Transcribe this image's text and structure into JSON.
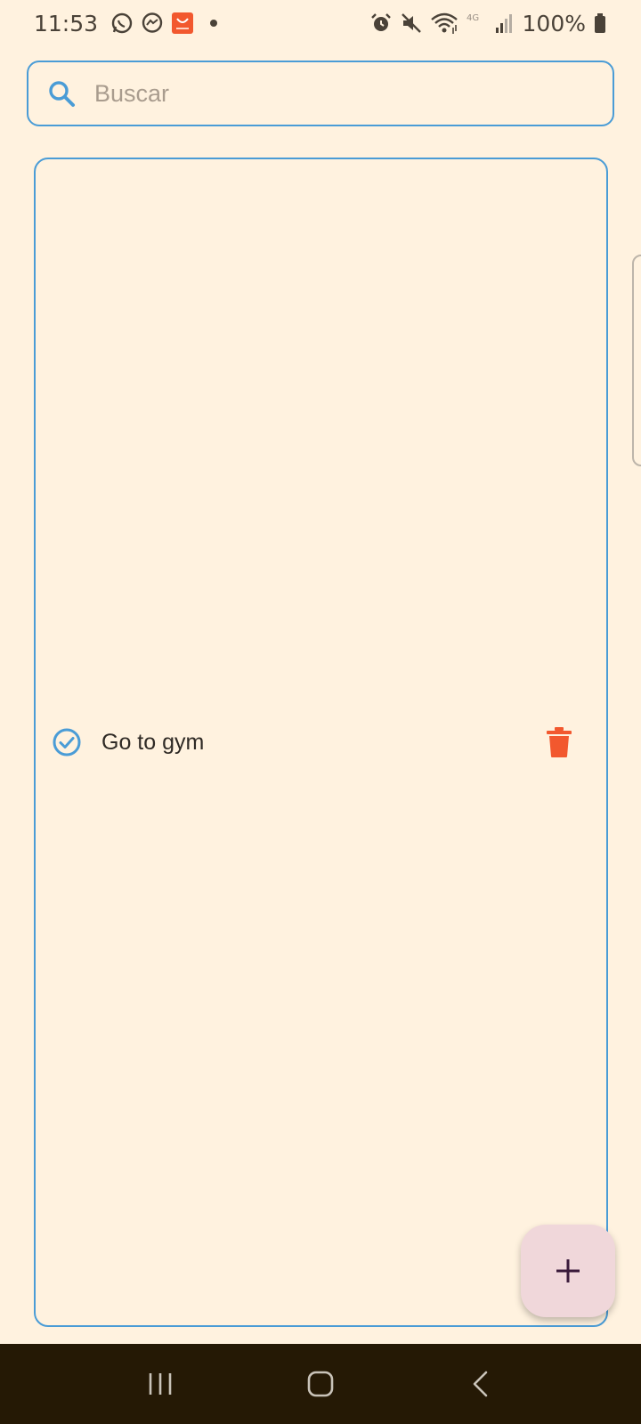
{
  "status_bar": {
    "time": "11:53",
    "battery": "100%",
    "left_icons": [
      "whatsapp-icon",
      "messenger-icon",
      "aliexpress-icon",
      "notification-dot"
    ],
    "right_icons": [
      "alarm-icon",
      "mute-icon",
      "wifi-icon",
      "4g-icon",
      "signal-icon",
      "battery-icon"
    ]
  },
  "search": {
    "placeholder": "Buscar",
    "value": ""
  },
  "tasks": [
    {
      "label": "Go to gym",
      "status_icon": "check-circle-icon",
      "action_icon": "trash-icon"
    }
  ],
  "fab": {
    "icon": "plus-icon"
  },
  "navigation": {
    "icons": [
      "recent-apps-icon",
      "home-icon",
      "back-icon"
    ]
  },
  "colors": {
    "background": "#FFF2DF",
    "accent": "#4A9CD6",
    "delete": "#F2582E",
    "fab": "#F0D7DA",
    "nav_bar": "#251905"
  }
}
